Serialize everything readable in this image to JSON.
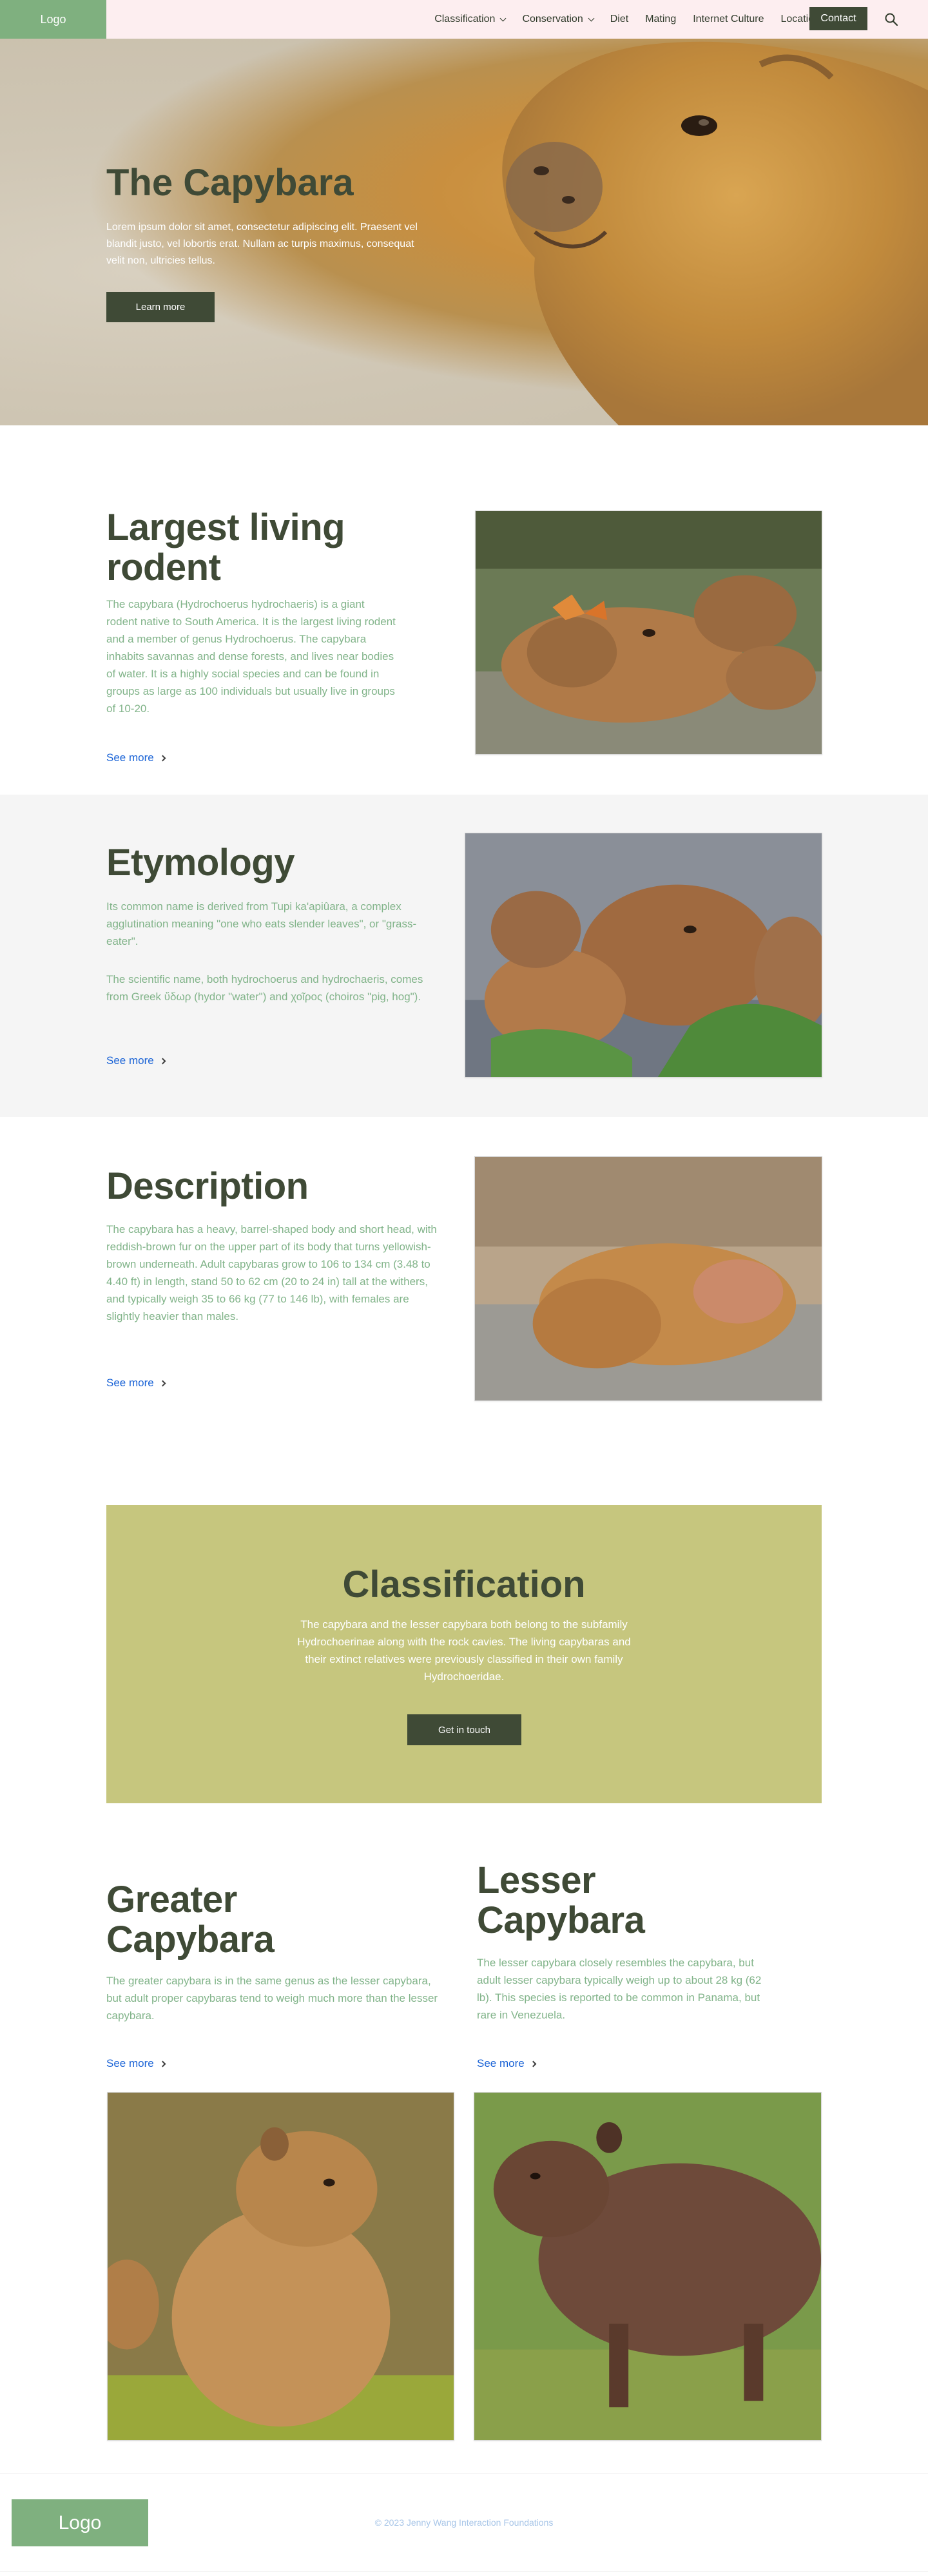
{
  "nav": {
    "logo": "Logo",
    "links": [
      {
        "label": "Classification",
        "dropdown": true
      },
      {
        "label": "Conservation",
        "dropdown": true
      },
      {
        "label": "Diet",
        "dropdown": false
      },
      {
        "label": "Mating",
        "dropdown": false
      },
      {
        "label": "Internet Culture",
        "dropdown": false
      },
      {
        "label": "Locations",
        "dropdown": false
      }
    ],
    "contact": "Contact",
    "search_icon": "search-icon"
  },
  "hero": {
    "title": "The Capybara",
    "text": "Lorem ipsum dolor sit amet, consectetur adipiscing elit. Praesent vel blandit justo, vel lobortis erat. Nullam ac turpis maximus, consequat velit non, ultricies tellus.",
    "button": "Learn more"
  },
  "sections": {
    "largest": {
      "title": "Largest living rodent",
      "body": "The capybara (Hydrochoerus hydrochaeris) is a giant rodent native to South America. It is the largest living rodent and a member of genus Hydrochoerus. The capybara inhabits savannas and dense forests, and lives near bodies of water. It is a highly social species and can be found in groups as large as 100 individuals but usually live in groups of 10-20.",
      "see_more": "See more"
    },
    "etymology": {
      "title": "Etymology",
      "body1": "Its common name is derived from Tupi ka'apiûara, a complex agglutination meaning \"one who eats slender leaves\", or \"grass-eater\".",
      "body2": "The scientific name, both hydrochoerus and hydrochaeris, comes from Greek ὕδωρ (hydor \"water\") and χοῖρος (choiros \"pig, hog\").",
      "see_more": "See more"
    },
    "description": {
      "title": "Description",
      "body": "The capybara has a heavy, barrel-shaped body and short head, with reddish-brown fur on the upper part of its body that turns yellowish-brown underneath. Adult capybaras grow to 106 to 134 cm (3.48 to 4.40 ft) in length, stand 50 to 62 cm (20 to 24 in) tall at the withers, and typically weigh 35 to 66 kg (77 to 146 lb), with females are slightly heavier than males.",
      "see_more": "See more"
    }
  },
  "classification": {
    "title": "Classification",
    "text": "The capybara and the lesser capybara both belong to the subfamily Hydrochoerinae along with the rock cavies. The living capybaras and their extinct relatives were previously classified in their own family Hydrochoeridae.",
    "button": "Get in touch"
  },
  "species": {
    "greater": {
      "title": "Greater Capybara",
      "body": "The greater capybara is in the same genus as the lesser capybara, but adult proper capybaras tend to weigh much more than the lesser capybara.",
      "see_more": "See more"
    },
    "lesser": {
      "title": "Lesser Capybara",
      "body": "The lesser capybara closely resembles the capybara, but adult lesser capybara typically weigh up to about 28 kg (62 lb). This species is reported to be common in Panama, but rare in Venezuela.",
      "see_more": "See more"
    }
  },
  "footer": {
    "logo": "Logo",
    "copyright": "© 2023 Jenny Wang Interaction Foundations"
  },
  "colors": {
    "accent_dark": "#3f4a36",
    "logo_green": "#7fb07f",
    "body_green": "#82b48a",
    "classification_bg": "#c6c67e",
    "link_blue": "#1a63d6",
    "nav_bg": "#fdeef0"
  }
}
